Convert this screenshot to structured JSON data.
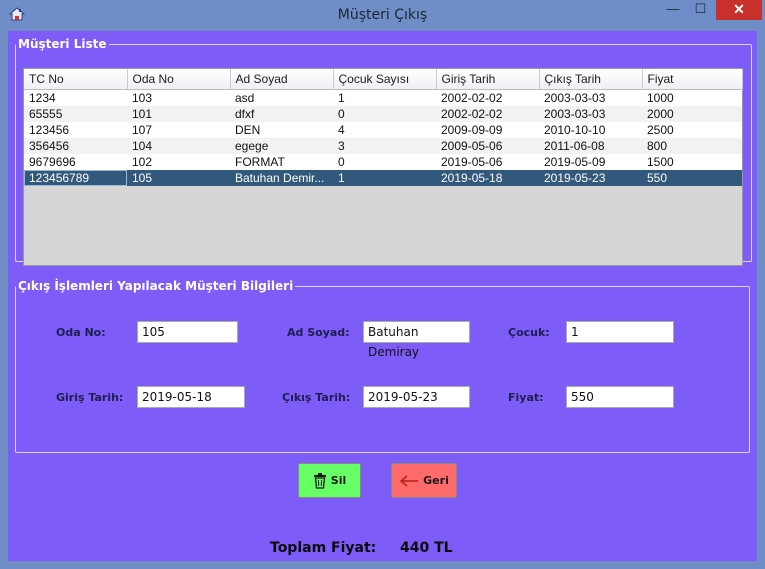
{
  "window": {
    "title": "Müşteri Çıkış",
    "minimize": "—",
    "maximize": "☐",
    "close": "✕"
  },
  "list_group": {
    "legend": "Müşteri Liste",
    "columns": [
      "TC No",
      "Oda No",
      "Ad Soyad",
      "Çocuk Sayısı",
      "Giriş Tarih",
      "Çıkış Tarih",
      "Fiyat"
    ],
    "rows": [
      [
        "1234",
        "103",
        "asd",
        "1",
        "2002-02-02",
        "2003-03-03",
        "1000"
      ],
      [
        "65555",
        "101",
        "dfxf",
        "0",
        "2002-02-02",
        "2003-03-03",
        "2000"
      ],
      [
        "123456",
        "107",
        "DEN",
        "4",
        "2009-09-09",
        "2010-10-10",
        "2500"
      ],
      [
        "356456",
        "104",
        "egege",
        "3",
        "2009-05-06",
        "2011-06-08",
        "800"
      ],
      [
        "9679696",
        "102",
        "FORMAT",
        "0",
        "2019-05-06",
        "2019-05-09",
        "1500"
      ],
      [
        "123456789",
        "105",
        "Batuhan Demir...",
        "1",
        "2019-05-18",
        "2019-05-23",
        "550"
      ]
    ],
    "selected_row": 5
  },
  "details_group": {
    "legend": "Çıkış İşlemleri Yapılacak Müşteri Bilgileri",
    "oda_no_label": "Oda No:",
    "oda_no_value": "105",
    "ad_soyad_label": "Ad Soyad:",
    "ad_soyad_value": "Batuhan Demiray",
    "cocuk_label": "Çocuk:",
    "cocuk_value": "1",
    "giris_label": "Giriş Tarih:",
    "giris_value": "2019-05-18",
    "cikis_label": "Çıkış Tarih:",
    "cikis_value": "2019-05-23",
    "fiyat_label": "Fiyat:",
    "fiyat_value": "550"
  },
  "buttons": {
    "sil": "Sil",
    "geri": "Geri"
  },
  "total": {
    "label": "Toplam Fiyat:",
    "value": "440 TL"
  },
  "colors": {
    "client_bg": "#7d5cf8",
    "selected_row": "#32597c",
    "sil_button": "#66ff66",
    "geri_button": "#ff6b6b",
    "close_button": "#c7302b"
  },
  "icons": {
    "app": "home-icon",
    "sil": "trash-icon",
    "geri": "arrow-left-icon"
  }
}
